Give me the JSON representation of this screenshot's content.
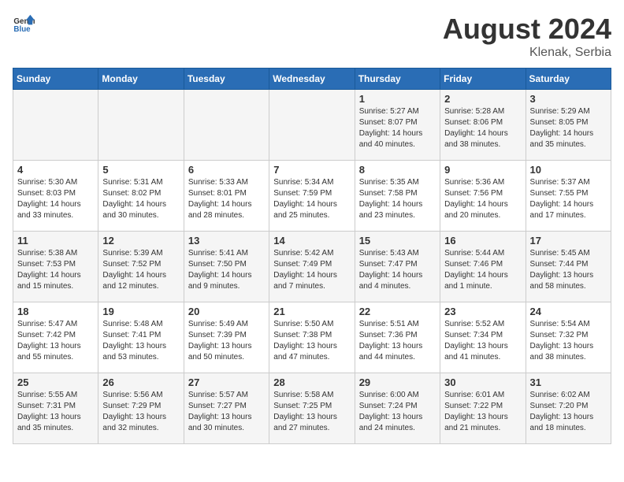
{
  "header": {
    "logo_general": "General",
    "logo_blue": "Blue",
    "month_year": "August 2024",
    "location": "Klenak, Serbia"
  },
  "days_of_week": [
    "Sunday",
    "Monday",
    "Tuesday",
    "Wednesday",
    "Thursday",
    "Friday",
    "Saturday"
  ],
  "weeks": [
    [
      {
        "day": "",
        "info": ""
      },
      {
        "day": "",
        "info": ""
      },
      {
        "day": "",
        "info": ""
      },
      {
        "day": "",
        "info": ""
      },
      {
        "day": "1",
        "info": "Sunrise: 5:27 AM\nSunset: 8:07 PM\nDaylight: 14 hours\nand 40 minutes."
      },
      {
        "day": "2",
        "info": "Sunrise: 5:28 AM\nSunset: 8:06 PM\nDaylight: 14 hours\nand 38 minutes."
      },
      {
        "day": "3",
        "info": "Sunrise: 5:29 AM\nSunset: 8:05 PM\nDaylight: 14 hours\nand 35 minutes."
      }
    ],
    [
      {
        "day": "4",
        "info": "Sunrise: 5:30 AM\nSunset: 8:03 PM\nDaylight: 14 hours\nand 33 minutes."
      },
      {
        "day": "5",
        "info": "Sunrise: 5:31 AM\nSunset: 8:02 PM\nDaylight: 14 hours\nand 30 minutes."
      },
      {
        "day": "6",
        "info": "Sunrise: 5:33 AM\nSunset: 8:01 PM\nDaylight: 14 hours\nand 28 minutes."
      },
      {
        "day": "7",
        "info": "Sunrise: 5:34 AM\nSunset: 7:59 PM\nDaylight: 14 hours\nand 25 minutes."
      },
      {
        "day": "8",
        "info": "Sunrise: 5:35 AM\nSunset: 7:58 PM\nDaylight: 14 hours\nand 23 minutes."
      },
      {
        "day": "9",
        "info": "Sunrise: 5:36 AM\nSunset: 7:56 PM\nDaylight: 14 hours\nand 20 minutes."
      },
      {
        "day": "10",
        "info": "Sunrise: 5:37 AM\nSunset: 7:55 PM\nDaylight: 14 hours\nand 17 minutes."
      }
    ],
    [
      {
        "day": "11",
        "info": "Sunrise: 5:38 AM\nSunset: 7:53 PM\nDaylight: 14 hours\nand 15 minutes."
      },
      {
        "day": "12",
        "info": "Sunrise: 5:39 AM\nSunset: 7:52 PM\nDaylight: 14 hours\nand 12 minutes."
      },
      {
        "day": "13",
        "info": "Sunrise: 5:41 AM\nSunset: 7:50 PM\nDaylight: 14 hours\nand 9 minutes."
      },
      {
        "day": "14",
        "info": "Sunrise: 5:42 AM\nSunset: 7:49 PM\nDaylight: 14 hours\nand 7 minutes."
      },
      {
        "day": "15",
        "info": "Sunrise: 5:43 AM\nSunset: 7:47 PM\nDaylight: 14 hours\nand 4 minutes."
      },
      {
        "day": "16",
        "info": "Sunrise: 5:44 AM\nSunset: 7:46 PM\nDaylight: 14 hours\nand 1 minute."
      },
      {
        "day": "17",
        "info": "Sunrise: 5:45 AM\nSunset: 7:44 PM\nDaylight: 13 hours\nand 58 minutes."
      }
    ],
    [
      {
        "day": "18",
        "info": "Sunrise: 5:47 AM\nSunset: 7:42 PM\nDaylight: 13 hours\nand 55 minutes."
      },
      {
        "day": "19",
        "info": "Sunrise: 5:48 AM\nSunset: 7:41 PM\nDaylight: 13 hours\nand 53 minutes."
      },
      {
        "day": "20",
        "info": "Sunrise: 5:49 AM\nSunset: 7:39 PM\nDaylight: 13 hours\nand 50 minutes."
      },
      {
        "day": "21",
        "info": "Sunrise: 5:50 AM\nSunset: 7:38 PM\nDaylight: 13 hours\nand 47 minutes."
      },
      {
        "day": "22",
        "info": "Sunrise: 5:51 AM\nSunset: 7:36 PM\nDaylight: 13 hours\nand 44 minutes."
      },
      {
        "day": "23",
        "info": "Sunrise: 5:52 AM\nSunset: 7:34 PM\nDaylight: 13 hours\nand 41 minutes."
      },
      {
        "day": "24",
        "info": "Sunrise: 5:54 AM\nSunset: 7:32 PM\nDaylight: 13 hours\nand 38 minutes."
      }
    ],
    [
      {
        "day": "25",
        "info": "Sunrise: 5:55 AM\nSunset: 7:31 PM\nDaylight: 13 hours\nand 35 minutes."
      },
      {
        "day": "26",
        "info": "Sunrise: 5:56 AM\nSunset: 7:29 PM\nDaylight: 13 hours\nand 32 minutes."
      },
      {
        "day": "27",
        "info": "Sunrise: 5:57 AM\nSunset: 7:27 PM\nDaylight: 13 hours\nand 30 minutes."
      },
      {
        "day": "28",
        "info": "Sunrise: 5:58 AM\nSunset: 7:25 PM\nDaylight: 13 hours\nand 27 minutes."
      },
      {
        "day": "29",
        "info": "Sunrise: 6:00 AM\nSunset: 7:24 PM\nDaylight: 13 hours\nand 24 minutes."
      },
      {
        "day": "30",
        "info": "Sunrise: 6:01 AM\nSunset: 7:22 PM\nDaylight: 13 hours\nand 21 minutes."
      },
      {
        "day": "31",
        "info": "Sunrise: 6:02 AM\nSunset: 7:20 PM\nDaylight: 13 hours\nand 18 minutes."
      }
    ]
  ]
}
